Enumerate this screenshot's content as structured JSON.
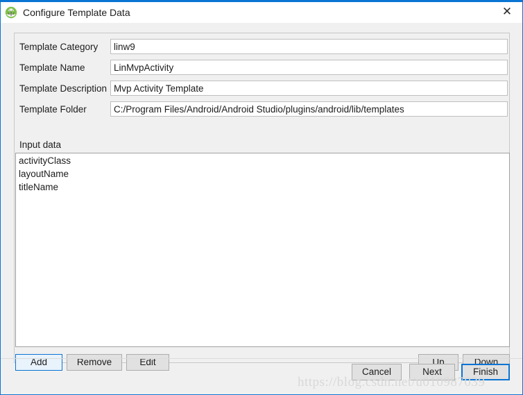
{
  "window": {
    "title": "Configure Template Data",
    "icon": "android-studio-icon",
    "close_label": "✕",
    "accent_color": "#0a74d4",
    "titlebar_bg": "#ffffff",
    "body_bg": "#f0f0f0"
  },
  "form": {
    "fields": [
      {
        "label": "Template Category",
        "value": "linw9",
        "placeholder": ""
      },
      {
        "label": "Template Name",
        "value": "LinMvpActivity",
        "placeholder": ""
      },
      {
        "label": "Template Description",
        "value": "Mvp Activity Template",
        "placeholder": ""
      },
      {
        "label": "Template Folder",
        "value": "C:/Program Files/Android/Android Studio/plugins/android/lib/templates",
        "placeholder": ""
      }
    ]
  },
  "input_data": {
    "label": "Input data",
    "items": [
      {
        "text": "activityClass"
      },
      {
        "text": "layoutName"
      },
      {
        "text": "titleName"
      }
    ]
  },
  "list_buttons": {
    "add": "Add",
    "remove": "Remove",
    "edit": "Edit",
    "up": "Up",
    "down": "Down"
  },
  "dialog_buttons": {
    "cancel": "Cancel",
    "next": "Next",
    "finish": "Finish"
  },
  "watermark": {
    "text": "https://blog.csdn.net/u010987039"
  }
}
